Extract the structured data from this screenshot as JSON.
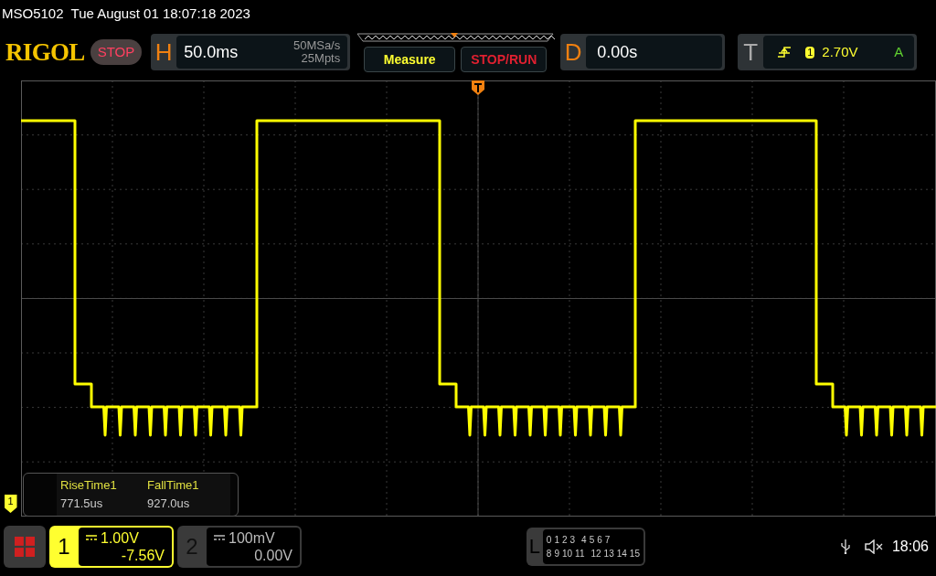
{
  "device": {
    "model": "MSO5102",
    "datetime": "Tue August 01 18:07:18 2023"
  },
  "toolbar": {
    "logo": "RIGOL",
    "run_state": "STOP",
    "horizontal": {
      "label": "H",
      "timebase": "50.0ms",
      "sample_rate": "50MSa/s",
      "memory_depth": "25Mpts"
    },
    "measure_button": "Measure",
    "stop_run_button": "STOP/RUN",
    "delay": {
      "label": "D",
      "value": "0.00s"
    },
    "trigger": {
      "label": "T",
      "source": "1",
      "level": "2.70V",
      "mode": "A"
    }
  },
  "channel_marker": "1",
  "measurements": [
    {
      "name": "RiseTime1",
      "value": "771.5us"
    },
    {
      "name": "FallTime1",
      "value": "927.0us"
    }
  ],
  "channels": [
    {
      "number": "1",
      "scale": "1.00V",
      "offset": "-7.56V",
      "selected": true
    },
    {
      "number": "2",
      "scale": "100mV",
      "offset": "0.00V",
      "selected": false
    }
  ],
  "logic": {
    "label": "L",
    "row_1": [
      "0",
      "1",
      "2",
      "3",
      "4",
      "5",
      "6",
      "7"
    ],
    "row_2": [
      "8",
      "9",
      "10",
      "11",
      "12",
      "13",
      "14",
      "15"
    ]
  },
  "status": {
    "time": "18:06"
  }
}
